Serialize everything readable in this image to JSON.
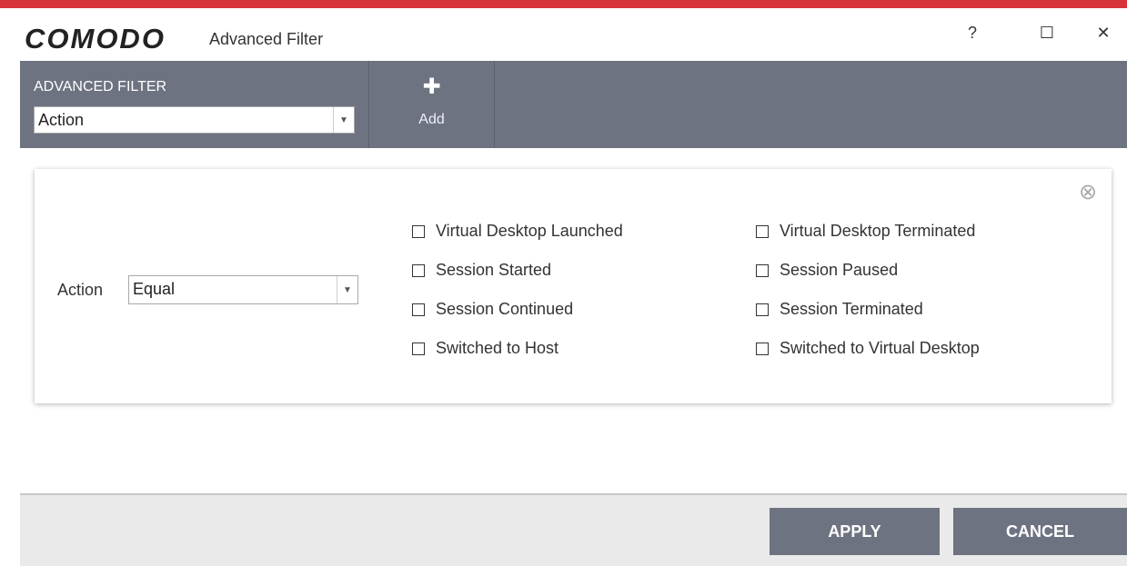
{
  "window": {
    "logo": "COMODO",
    "title": "Advanced Filter",
    "help": "?",
    "maximize": "☐",
    "close": "✕"
  },
  "toolbar": {
    "filter_label": "ADVANCED FILTER",
    "filter_value": "Action",
    "add_label": "Add",
    "add_icon": "✚"
  },
  "filter": {
    "field_label": "Action",
    "operator": "Equal",
    "remove_icon": "⊗",
    "options": [
      "Virtual Desktop Launched",
      "Session Started",
      "Session Continued",
      "Switched to Host",
      "Virtual Desktop Terminated",
      "Session Paused",
      "Session Terminated",
      "Switched to Virtual Desktop"
    ]
  },
  "footer": {
    "apply": "APPLY",
    "cancel": "CANCEL"
  }
}
